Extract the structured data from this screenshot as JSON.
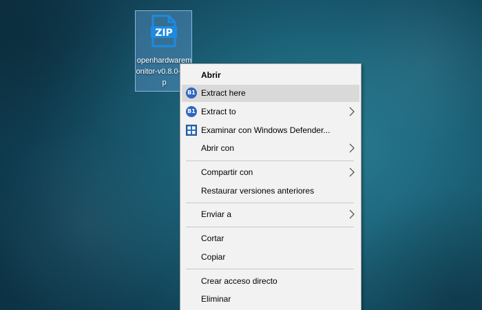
{
  "desktop": {
    "file": {
      "name": "openhardwaremonitor-v0.8.0-a.zip",
      "icon": "zip-file-icon"
    }
  },
  "context_menu": {
    "items": [
      {
        "label": "Abrir",
        "bold": true
      },
      {
        "label": "Extract here",
        "icon": "b1-icon",
        "icon_text": "B1",
        "highlighted": true
      },
      {
        "label": "Extract to",
        "icon": "b1-icon",
        "icon_text": "B1",
        "submenu": true
      },
      {
        "label": "Examinar con Windows Defender...",
        "icon": "windows-defender-icon"
      },
      {
        "label": "Abrir con",
        "submenu": true
      },
      {
        "label": "Compartir con",
        "submenu": true
      },
      {
        "label": "Restaurar versiones anteriores"
      },
      {
        "label": "Enviar a",
        "submenu": true
      },
      {
        "label": "Cortar"
      },
      {
        "label": "Copiar"
      },
      {
        "label": "Crear acceso directo"
      },
      {
        "label": "Eliminar"
      }
    ]
  },
  "colors": {
    "zip_icon": "#1e8ae0",
    "menu_background": "#f2f2f2",
    "menu_highlight": "#d9d9d9",
    "b1_icon": "#2f65c0"
  }
}
